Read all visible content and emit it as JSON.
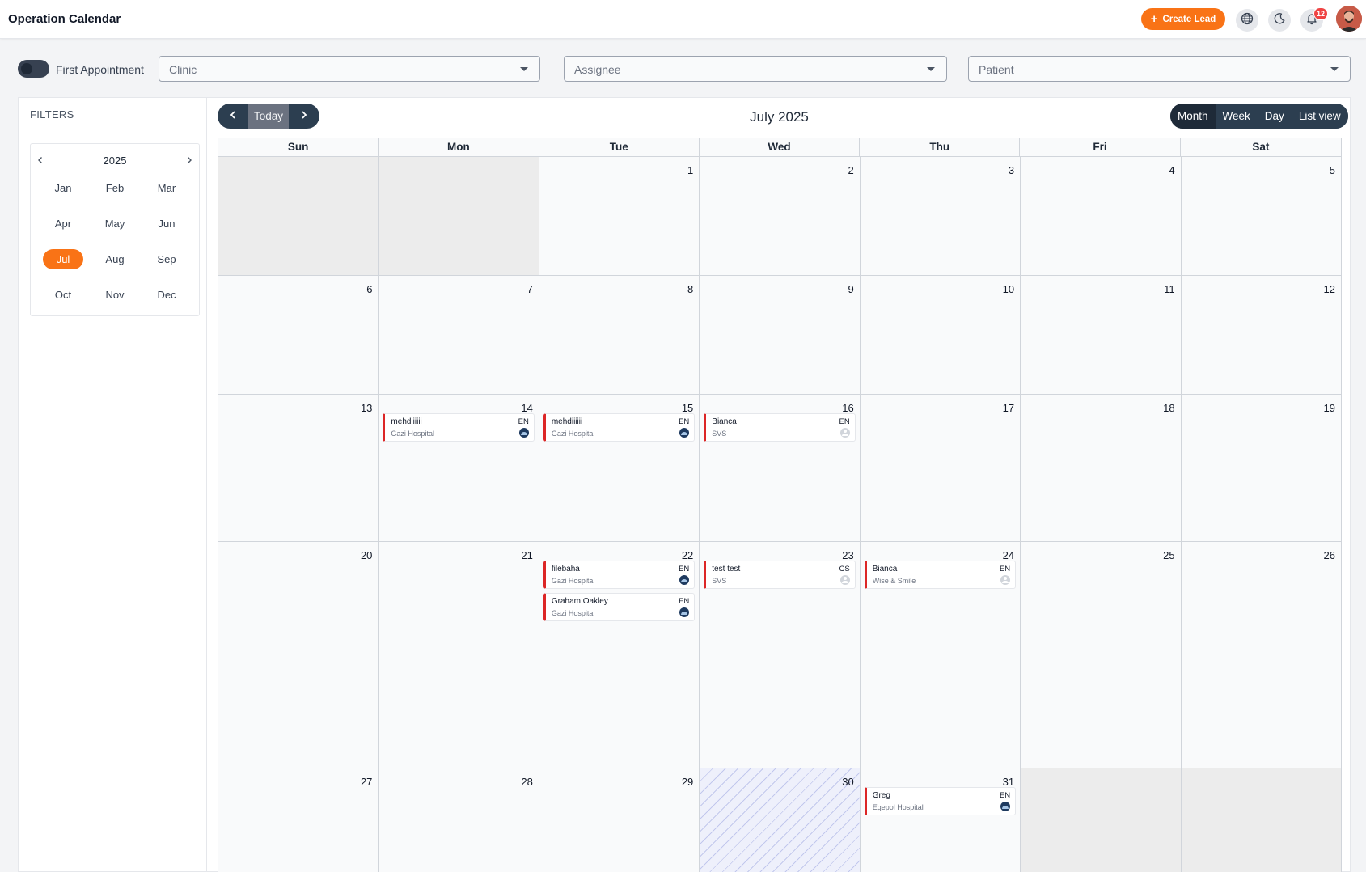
{
  "app": {
    "title": "Operation Calendar"
  },
  "header": {
    "create_lead_label": "Create Lead",
    "notification_count": "12",
    "icons": [
      "plus-icon",
      "globe-icon",
      "moon-icon",
      "bell-icon"
    ],
    "accent_color": "#f97316"
  },
  "filter_bar": {
    "first_appointment_label": "First Appointment",
    "first_appointment_enabled": false,
    "clinic_placeholder": "Clinic",
    "assignee_placeholder": "Assignee",
    "patient_placeholder": "Patient"
  },
  "sidebar": {
    "title": "FILTERS",
    "year": "2025",
    "selected_month": "Jul",
    "months": [
      "Jan",
      "Feb",
      "Mar",
      "Apr",
      "May",
      "Jun",
      "Jul",
      "Aug",
      "Sep",
      "Oct",
      "Nov",
      "Dec"
    ]
  },
  "calendar": {
    "today_label": "Today",
    "title": "July 2025",
    "views": [
      "Month",
      "Week",
      "Day",
      "List view"
    ],
    "active_view": "Month",
    "weekdays": [
      "Sun",
      "Mon",
      "Tue",
      "Wed",
      "Thu",
      "Fri",
      "Sat"
    ],
    "today_date": "30",
    "weeks": [
      [
        "",
        "",
        "1",
        "2",
        "3",
        "4",
        "5"
      ],
      [
        "6",
        "7",
        "8",
        "9",
        "10",
        "11",
        "12"
      ],
      [
        "13",
        "14",
        "15",
        "16",
        "17",
        "18",
        "19"
      ],
      [
        "20",
        "21",
        "22",
        "23",
        "24",
        "25",
        "26"
      ],
      [
        "27",
        "28",
        "29",
        "30",
        "31",
        "",
        ""
      ]
    ],
    "events": {
      "14": [
        {
          "name": "mehdiiiiii",
          "clinic": "Gazi Hospital",
          "lang": "EN",
          "icon": "hospital-icon"
        }
      ],
      "15": [
        {
          "name": "mehdiiiiii",
          "clinic": "Gazi Hospital",
          "lang": "EN",
          "icon": "hospital-icon"
        }
      ],
      "16": [
        {
          "name": "Bianca",
          "clinic": "SVS",
          "lang": "EN",
          "icon": "person-icon"
        }
      ],
      "22": [
        {
          "name": "filebaha",
          "clinic": "Gazi Hospital",
          "lang": "EN",
          "icon": "hospital-icon"
        },
        {
          "name": "Graham Oakley",
          "clinic": "Gazi Hospital",
          "lang": "EN",
          "icon": "hospital-icon"
        }
      ],
      "23": [
        {
          "name": "test test",
          "clinic": "SVS",
          "lang": "CS",
          "icon": "person-icon"
        }
      ],
      "24": [
        {
          "name": "Bianca",
          "clinic": "Wise & Smile",
          "lang": "EN",
          "icon": "person-icon"
        }
      ],
      "31": [
        {
          "name": "Greg",
          "clinic": "Egepol Hospital",
          "lang": "EN",
          "icon": "hospital-icon"
        }
      ]
    },
    "event_accent_color": "#dc2626"
  }
}
